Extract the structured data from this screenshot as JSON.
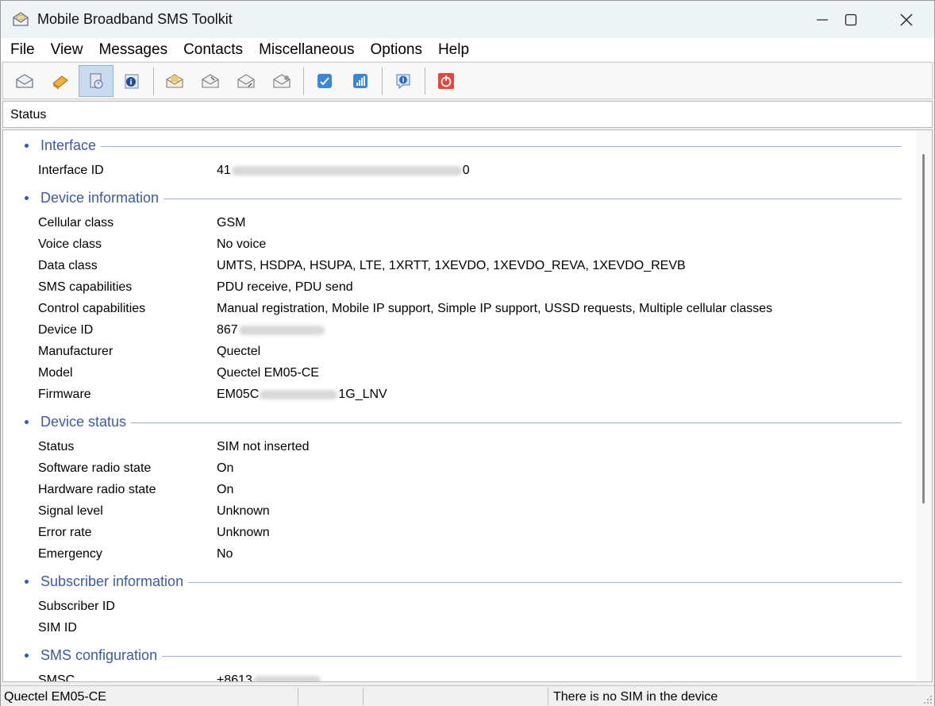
{
  "window": {
    "title": "Mobile Broadband SMS Toolkit"
  },
  "menu": [
    "File",
    "View",
    "Messages",
    "Contacts",
    "Miscellaneous",
    "Options",
    "Help"
  ],
  "toolbar": {
    "buttons": [
      {
        "icon": "envelope-icon"
      },
      {
        "icon": "contacts-book-icon"
      },
      {
        "icon": "status-icon",
        "active": true
      },
      {
        "icon": "device-info-icon"
      },
      {
        "icon": "new-message-icon"
      },
      {
        "icon": "inbox-icon"
      },
      {
        "icon": "outbox-icon"
      },
      {
        "icon": "sent-icon"
      },
      {
        "icon": "ussd-icon"
      },
      {
        "icon": "signal-icon"
      },
      {
        "icon": "about-icon"
      },
      {
        "icon": "power-icon"
      }
    ]
  },
  "status_header": "Status",
  "sections": {
    "interface": {
      "title": "Interface",
      "rows": [
        {
          "label": "Interface ID",
          "value_prefix": "41",
          "value_suffix": "0"
        }
      ]
    },
    "device_information": {
      "title": "Device information",
      "rows": [
        {
          "label": "Cellular class",
          "value": "GSM"
        },
        {
          "label": "Voice class",
          "value": "No voice"
        },
        {
          "label": "Data class",
          "value": "UMTS, HSDPA, HSUPA, LTE, 1XRTT, 1XEVDO, 1XEVDO_REVA, 1XEVDO_REVB"
        },
        {
          "label": "SMS capabilities",
          "value": "PDU receive, PDU send"
        },
        {
          "label": "Control capabilities",
          "value": "Manual registration, Mobile IP support, Simple IP support, USSD requests, Multiple cellular classes"
        },
        {
          "label": "Device ID",
          "value_prefix": "867",
          "value_suffix": ""
        },
        {
          "label": "Manufacturer",
          "value": "Quectel"
        },
        {
          "label": "Model",
          "value": "Quectel EM05-CE"
        },
        {
          "label": "Firmware",
          "value_prefix": "EM05C",
          "value_suffix": "1G_LNV"
        }
      ]
    },
    "device_status": {
      "title": "Device status",
      "rows": [
        {
          "label": "Status",
          "value": "SIM not inserted"
        },
        {
          "label": "Software radio state",
          "value": "On"
        },
        {
          "label": "Hardware radio state",
          "value": "On"
        },
        {
          "label": "Signal level",
          "value": "Unknown"
        },
        {
          "label": "Error rate",
          "value": "Unknown"
        },
        {
          "label": "Emergency",
          "value": "No"
        }
      ]
    },
    "subscriber_information": {
      "title": "Subscriber information",
      "rows": [
        {
          "label": "Subscriber ID",
          "value": ""
        },
        {
          "label": "SIM ID",
          "value": ""
        }
      ]
    },
    "sms_configuration": {
      "title": "SMS configuration",
      "rows": [
        {
          "label": "SMSC",
          "value_prefix": "+8613",
          "value_suffix": ""
        }
      ]
    }
  },
  "statusbar": {
    "device": "Quectel EM05-CE",
    "message": "There is no SIM in the device"
  },
  "colors": {
    "section_title": "#3b5ba5",
    "section_line": "#9fb1d8",
    "toolbar_active": "#c9dcef"
  }
}
